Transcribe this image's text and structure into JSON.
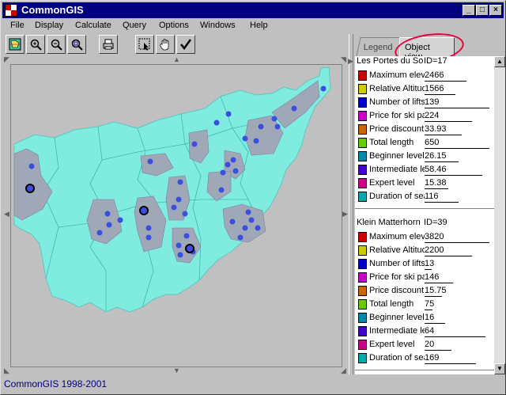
{
  "window": {
    "title": "CommonGIS",
    "controls": [
      "_",
      "□",
      "×"
    ]
  },
  "menu": [
    "File",
    "Display",
    "Calculate",
    "Query",
    "Options",
    "Windows",
    "Help"
  ],
  "toolbar": {
    "tools": [
      "map-view",
      "zoom-in",
      "zoom-out",
      "zoom-fit",
      "print",
      "select",
      "pan",
      "apply"
    ]
  },
  "tabs": {
    "legend": "Legend",
    "object_view": "Object view"
  },
  "objects": [
    {
      "name": "Les Portes du Soleil",
      "id": "ID=17",
      "attributes": [
        {
          "name": "Maximum elevation",
          "value": "2466",
          "color": "#cc0000",
          "fill": 0.62
        },
        {
          "name": "Relative Altitude",
          "value": "1566",
          "color": "#cccc00",
          "fill": 0.45
        },
        {
          "name": "Number of lifts",
          "value": "139",
          "color": "#0000cc",
          "fill": 0.95
        },
        {
          "name": "Price for ski pass",
          "value": "224",
          "color": "#cc00cc",
          "fill": 0.7
        },
        {
          "name": "Price discount",
          "value": "33.93",
          "color": "#cc6600",
          "fill": 0.55
        },
        {
          "name": "Total length",
          "value": "650",
          "color": "#66cc00",
          "fill": 0.95
        },
        {
          "name": "Beginner level",
          "value": "26.15",
          "color": "#0088aa",
          "fill": 0.5
        },
        {
          "name": "Intermediate level",
          "value": "58.46",
          "color": "#4400cc",
          "fill": 0.85
        },
        {
          "name": "Expert level",
          "value": "15.38",
          "color": "#cc0088",
          "fill": 0.35
        },
        {
          "name": "Duration of season",
          "value": "116",
          "color": "#00aaaa",
          "fill": 0.5
        }
      ]
    },
    {
      "name": "Klein Matterhorn",
      "id": "ID=39",
      "attributes": [
        {
          "name": "Maximum elevation",
          "value": "3820",
          "color": "#cc0000",
          "fill": 0.95
        },
        {
          "name": "Relative Altitude",
          "value": "2200",
          "color": "#cccc00",
          "fill": 0.7
        },
        {
          "name": "Number of lifts",
          "value": "13",
          "color": "#0000cc",
          "fill": 0.1
        },
        {
          "name": "Price for ski pass",
          "value": "146",
          "color": "#cc00cc",
          "fill": 0.42
        },
        {
          "name": "Price discount",
          "value": "15.75",
          "color": "#cc6600",
          "fill": 0.25
        },
        {
          "name": "Total length",
          "value": "75",
          "color": "#66cc00",
          "fill": 0.12
        },
        {
          "name": "Beginner level",
          "value": "16",
          "color": "#0088aa",
          "fill": 0.3
        },
        {
          "name": "Intermediate level",
          "value": "64",
          "color": "#4400cc",
          "fill": 0.9
        },
        {
          "name": "Expert level",
          "value": "20",
          "color": "#cc0088",
          "fill": 0.4
        },
        {
          "name": "Duration of season",
          "value": "169",
          "color": "#00aaaa",
          "fill": 0.75
        }
      ]
    }
  ],
  "status": "CommonGIS 1998-2001",
  "colors": {
    "titlebar": "#000080",
    "map_region": "#80ece0",
    "highlight_region": "#a0a8b8",
    "point": "#3a4ee0",
    "annotation": "#e8003c"
  }
}
